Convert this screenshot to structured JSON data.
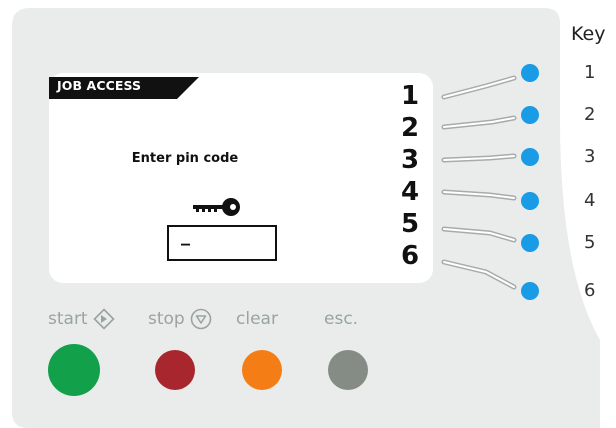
{
  "screen": {
    "header": "JOB ACCESS",
    "prompt": "Enter pin code",
    "pin_value": "–",
    "lines": [
      "1",
      "2",
      "3",
      "4",
      "5",
      "6"
    ]
  },
  "key_legend": {
    "heading": "Key",
    "items": [
      "1",
      "2",
      "3",
      "4",
      "5",
      "6"
    ]
  },
  "buttons": {
    "start": {
      "label": "start",
      "icon": "diamond-arrow-icon",
      "color": "#12a14a"
    },
    "stop": {
      "label": "stop",
      "icon": "stop-triangle-icon",
      "color": "#a8262e"
    },
    "clear": {
      "label": "clear",
      "color": "#f57d16"
    },
    "esc": {
      "label": "esc.",
      "color": "#858c85"
    }
  },
  "colors": {
    "panel": "#e9ecea",
    "side_key": "#1a9be6",
    "screen_header": "#111111"
  }
}
